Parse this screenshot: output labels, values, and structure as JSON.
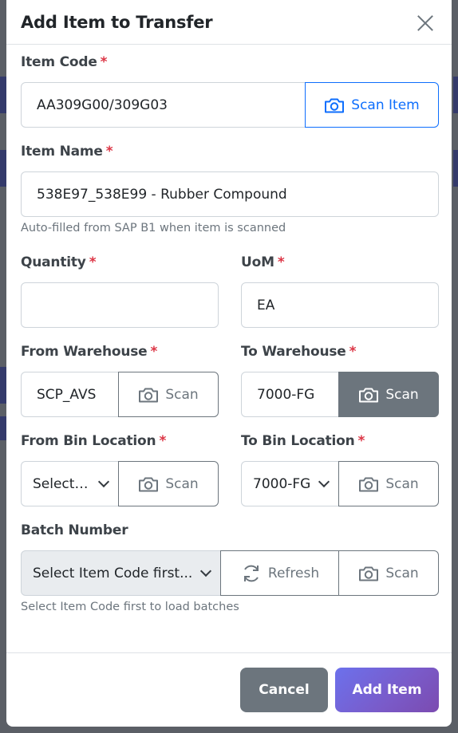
{
  "modal": {
    "title": "Add Item to Transfer",
    "close_icon": "close-icon"
  },
  "item_code": {
    "label": "Item Code",
    "required_mark": "*",
    "value": "AA309G00/309G03",
    "scan_label": "Scan Item",
    "scan_icon": "camera-icon"
  },
  "item_name": {
    "label": "Item Name",
    "required_mark": "*",
    "value": "538E97_538E99 - Rubber Compound",
    "hint": "Auto-filled from SAP B1 when item is scanned"
  },
  "quantity": {
    "label": "Quantity",
    "required_mark": "*",
    "value": ""
  },
  "uom": {
    "label": "UoM",
    "required_mark": "*",
    "value": "EA"
  },
  "from_warehouse": {
    "label": "From Warehouse",
    "required_mark": "*",
    "value": "SCP_AVS",
    "scan_label": "Scan"
  },
  "to_warehouse": {
    "label": "To Warehouse",
    "required_mark": "*",
    "value": "7000-FG",
    "scan_label": "Scan"
  },
  "from_bin": {
    "label": "From Bin Location",
    "required_mark": "*",
    "selected": "Select Bi",
    "scan_label": "Scan"
  },
  "to_bin": {
    "label": "To Bin Location",
    "required_mark": "*",
    "selected": "7000-FG",
    "scan_label": "Scan"
  },
  "batch": {
    "label": "Batch Number",
    "selected": "Select Item Code first...",
    "refresh_label": "Refresh",
    "refresh_icon": "refresh-icon",
    "scan_label": "Scan",
    "hint": "Select Item Code first to load batches"
  },
  "footer": {
    "cancel_label": "Cancel",
    "add_label": "Add Item"
  },
  "colors": {
    "primary": "#0d6efd",
    "secondary": "#6c757d",
    "required": "#dc3545",
    "add_gradient_start": "#6c71ec",
    "add_gradient_end": "#7b4bb0"
  }
}
